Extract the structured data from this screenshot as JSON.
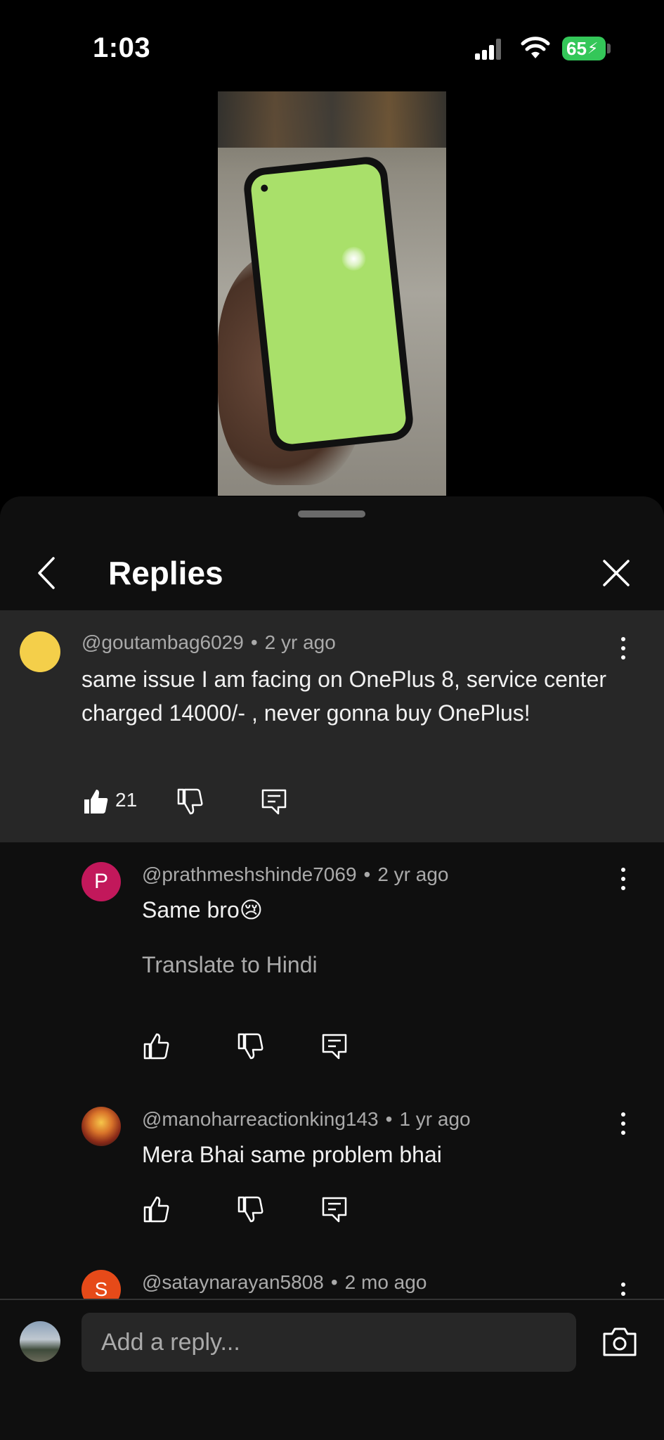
{
  "status_bar": {
    "time": "1:03",
    "battery": "65"
  },
  "sheet": {
    "title": "Replies"
  },
  "parent_comment": {
    "author": "@goutambag6029",
    "age": "2 yr ago",
    "text": "same issue I am facing on OnePlus 8, service center charged 14000/- ,  never gonna buy OnePlus!",
    "likes": "21"
  },
  "replies": [
    {
      "author": "@prathmeshshinde7069",
      "age": "2 yr ago",
      "text": "Same bro",
      "emoji": "😢",
      "avatar_letter": "P",
      "translate": "Translate to Hindi"
    },
    {
      "author": "@manoharreactionking143",
      "age": "1 yr ago",
      "text": "Mera Bhai same problem bhai"
    },
    {
      "author": "@sataynarayan5808",
      "age": "2 mo ago",
      "avatar_letter": "S"
    }
  ],
  "composer": {
    "placeholder": "Add a reply..."
  },
  "separator": "•",
  "colors": {
    "background": "#0f0f0f",
    "highlight": "#272727",
    "battery": "#34c759"
  },
  "icons": [
    "back-icon",
    "close-icon",
    "like-icon",
    "dislike-icon",
    "reply-icon",
    "more-icon",
    "camera-icon"
  ]
}
